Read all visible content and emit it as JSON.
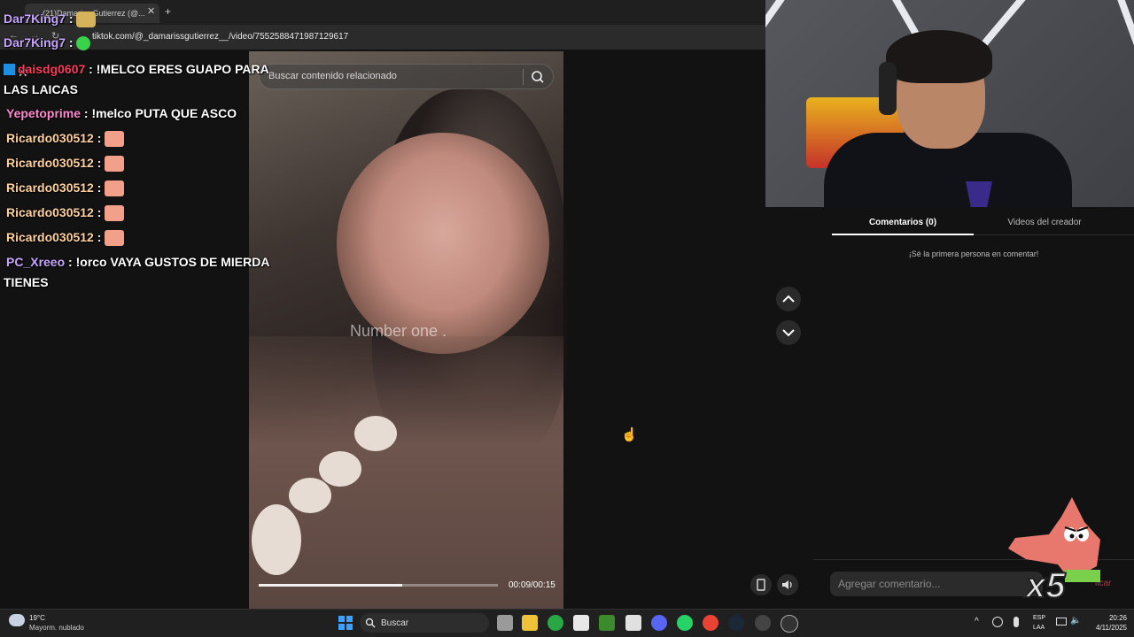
{
  "browser": {
    "tab_title": "(21)Damariss Gutierrez (@...",
    "new_tab_symbol": "+",
    "url": "tiktok.com/@_damarissgutierrez__/video/7552588471987129617"
  },
  "video": {
    "search_placeholder": "Buscar contenido relacionado",
    "caption": "Number one .",
    "time": "00:09/00:15",
    "progress": 0.6
  },
  "comments": {
    "tab_comments": "Comentarios (0)",
    "tab_creator": "Videos del creador",
    "empty_message": "¡Sé la primera persona en comentar!",
    "input_placeholder": "Agregar comentario...",
    "publish_label": "licar"
  },
  "chat": {
    "lines": [
      {
        "user": "Dar7King7",
        "text": ""
      },
      {
        "user": "Dar7King7",
        "text": ""
      },
      {
        "user": "daisdg0607",
        "text": "!MELCO ERES GUAPO PARA",
        "cont": "LAS LAICAS"
      },
      {
        "user": "Yepetoprime",
        "text": "!melco PUTA QUE ASCO"
      },
      {
        "user": "Ricardo030512",
        "text": ""
      },
      {
        "user": "Ricardo030512",
        "text": ""
      },
      {
        "user": "Ricardo030512",
        "text": ""
      },
      {
        "user": "Ricardo030512",
        "text": ""
      },
      {
        "user": "Ricardo030512",
        "text": ""
      },
      {
        "user": "PC_Xreeo",
        "text": "!orco VAYA GUSTOS DE MIERDA",
        "cont": "TIENES"
      }
    ],
    "separator": ":"
  },
  "sticker": {
    "multiplier": "x5"
  },
  "taskbar": {
    "weather_temp": "19°C",
    "weather_desc": "Mayorm. nublado",
    "search_label": "Buscar",
    "lang_top": "ESP",
    "lang_bottom": "LAA",
    "time": "20:26",
    "date": "4/11/2025"
  },
  "icons": [
    "close-icon",
    "search-icon",
    "chevron-up-icon",
    "chevron-down-icon",
    "volume-icon",
    "device-icon",
    "windows-start-icon"
  ],
  "colors": {
    "page_bg": "#121212",
    "publish": "#a53a4a",
    "user_lilac": "#c7a6ff",
    "user_orange": "#ffd0a0",
    "user_pink": "#ff8ad0",
    "user_red": "#ff3b5c"
  }
}
